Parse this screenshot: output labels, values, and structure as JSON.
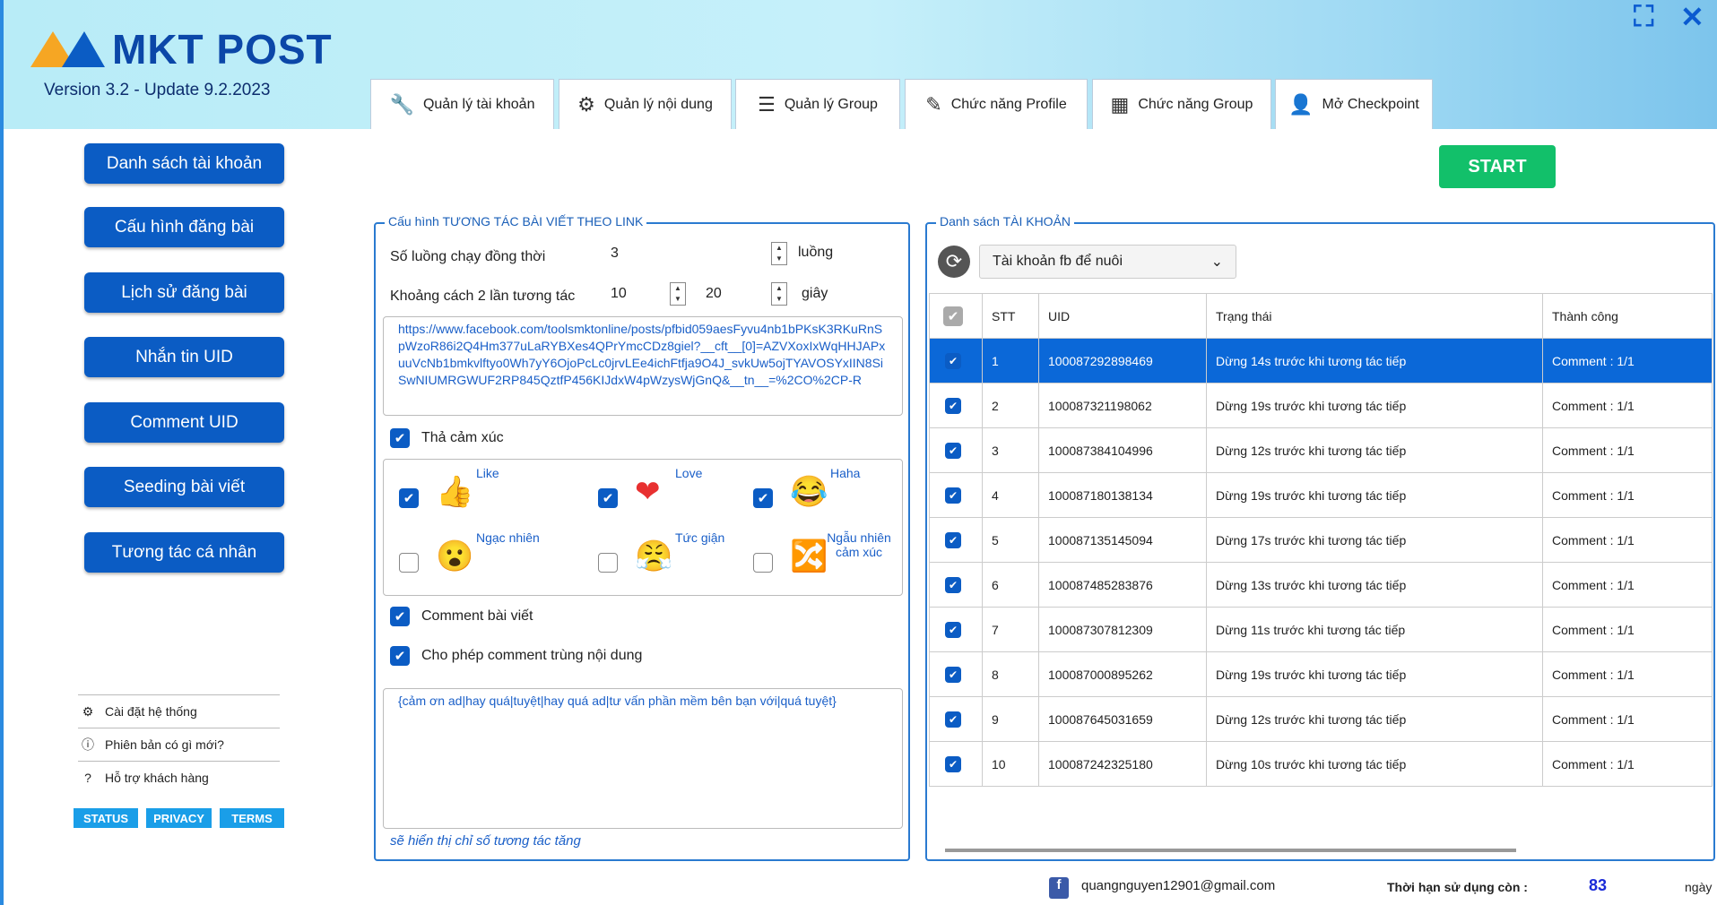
{
  "app": {
    "name": "MKT POST",
    "version": "Version 3.2 - Update 9.2.2023"
  },
  "tabs": [
    {
      "label": "Quản lý tài khoản",
      "icon": "wrench-icon",
      "glyph": "🔧"
    },
    {
      "label": "Quản lý nội dung",
      "icon": "gear-refresh-icon",
      "glyph": "⚙"
    },
    {
      "label": "Quản lý Group",
      "icon": "list-icon",
      "glyph": "☰"
    },
    {
      "label": "Chức năng Profile",
      "icon": "pencil-icon",
      "glyph": "✎"
    },
    {
      "label": "Chức năng Group",
      "icon": "calendar-icon",
      "glyph": "▦"
    },
    {
      "label": "Mở Checkpoint",
      "icon": "user-icon",
      "glyph": "👤"
    }
  ],
  "sidebar": {
    "items": [
      "Danh sách tài khoản",
      "Cấu hình đăng bài",
      "Lịch sử đăng bài",
      "Nhắn tin UID",
      "Comment UID",
      "Seeding bài viết",
      "Tương tác cá nhân"
    ],
    "links": [
      {
        "label": "Cài đặt hệ thống",
        "glyph": "⚙"
      },
      {
        "label": "Phiên bản có gì mới?",
        "glyph": "ⓘ"
      },
      {
        "label": "Hỗ trợ khách hàng",
        "glyph": "?"
      }
    ],
    "buttons": [
      "STATUS",
      "PRIVACY",
      "TERMS"
    ]
  },
  "start_label": "START",
  "config": {
    "title": "Cấu hình TƯƠNG TÁC BÀI VIẾT THEO LINK",
    "threads_label": "Số luồng chạy đồng thời",
    "threads": "3",
    "threads_unit": "luồng",
    "interval_label": "Khoảng cách 2 lần tương tác",
    "interval_min": "10",
    "interval_max": "20",
    "interval_unit": "giây",
    "url": "https://www.facebook.com/toolsmktonline/posts/pfbid059aesFyvu4nb1bPKsK3RKuRnSpWzoR86i2Q4Hm377uLaRYBXes4QPrYmcCDz8giel?__cft__[0]=AZVXoxIxWqHHJAPxuuVcNb1bmkvlftyo0Wh7yY6OjoPcLc0jrvLEe4ichFtfja9O4J_svkUw5ojTYAVOSYxIIN8SiSwNIUMRGWUF2RP845QztfP456KIJdxW4pWzysWjGnQ&__tn__=%2CO%2CP-R",
    "react_label": "Thả cảm xúc",
    "react_checked": true,
    "reactions": [
      {
        "label": "Like",
        "checked": true,
        "glyph": "👍"
      },
      {
        "label": "Love",
        "checked": true,
        "glyph": "❤"
      },
      {
        "label": "Haha",
        "checked": true,
        "glyph": "😂"
      },
      {
        "label": "Ngạc nhiên",
        "checked": false,
        "glyph": "😮"
      },
      {
        "label": "Tức giận",
        "checked": false,
        "glyph": "😤"
      },
      {
        "label": "Ngẫu nhiên cảm xúc",
        "checked": false,
        "glyph": "🔀"
      }
    ],
    "comment_label": "Comment bài viết",
    "comment_checked": true,
    "dup_label": "Cho phép comment trùng nội dung",
    "dup_checked": true,
    "comment_text": "{cảm ơn ad|hay quá|tuyệt|hay quá ad|tư vấn phần mềm bên bạn với|quá tuyệt}",
    "hint": "sẽ hiển thị chỉ số tương tác tăng"
  },
  "accounts": {
    "title": "Danh sách TÀI KHOẢN",
    "dropdown": "Tài khoản fb để nuôi",
    "columns": [
      "STT",
      "UID",
      "Trạng thái",
      "Thành công"
    ],
    "rows": [
      [
        "1",
        "100087292898469",
        "Dừng 14s trước khi tương tác tiếp",
        "Comment : 1/1"
      ],
      [
        "2",
        "100087321198062",
        "Dừng 19s trước khi tương tác tiếp",
        "Comment : 1/1"
      ],
      [
        "3",
        "100087384104996",
        "Dừng 12s trước khi tương tác tiếp",
        "Comment : 1/1"
      ],
      [
        "4",
        "100087180138134",
        "Dừng 19s trước khi tương tác tiếp",
        "Comment : 1/1"
      ],
      [
        "5",
        "100087135145094",
        "Dừng 17s trước khi tương tác tiếp",
        "Comment : 1/1"
      ],
      [
        "6",
        "100087485283876",
        "Dừng 13s trước khi tương tác tiếp",
        "Comment : 1/1"
      ],
      [
        "7",
        "100087307812309",
        "Dừng 11s trước khi tương tác tiếp",
        "Comment : 1/1"
      ],
      [
        "8",
        "100087000895262",
        "Dừng 19s trước khi tương tác tiếp",
        "Comment : 1/1"
      ],
      [
        "9",
        "100087645031659",
        "Dừng 12s trước khi tương tác tiếp",
        "Comment : 1/1"
      ],
      [
        "10",
        "100087242325180",
        "Dừng 10s trước khi tương tác tiếp",
        "Comment : 1/1"
      ]
    ]
  },
  "footer": {
    "email": "quangnguyen12901@gmail.com",
    "expiry_label": "Thời hạn sử dụng còn :",
    "expiry_value": "83",
    "expiry_unit": "ngày"
  },
  "colors": {
    "primary": "#0b5cc4",
    "start": "#12c06a",
    "selected_row": "#0b68d8"
  }
}
